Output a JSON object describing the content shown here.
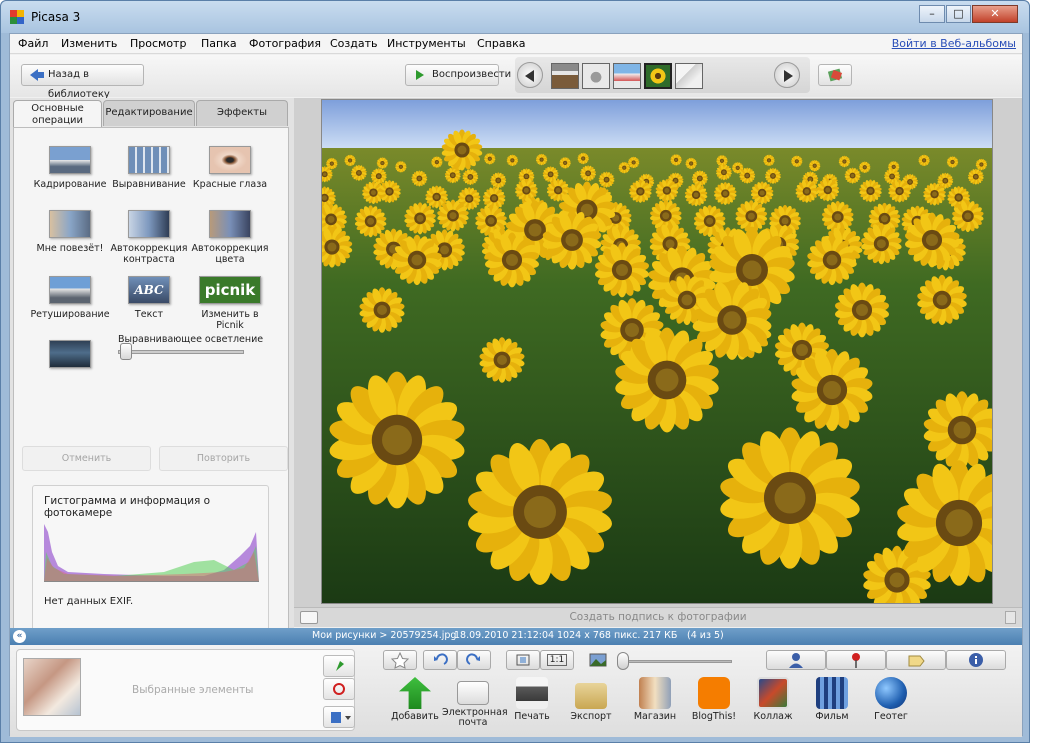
{
  "window": {
    "title": "Picasa 3",
    "controls": [
      "–",
      "□",
      "✕"
    ]
  },
  "menu": {
    "items": [
      "Файл",
      "Изменить",
      "Просмотр",
      "Папка",
      "Фотография",
      "Создать",
      "Инструменты",
      "Справка"
    ],
    "web_albums_link": "Войти в Веб-альбомы"
  },
  "toolbar": {
    "back_label": "Назад в библиотеку",
    "play_label": "Воспроизвести"
  },
  "tabs": [
    {
      "label": "Основные\nоперации",
      "active": true
    },
    {
      "label": "Редактирование",
      "active": false
    },
    {
      "label": "Эффекты",
      "active": false
    }
  ],
  "tools": [
    {
      "label": "Кадрирование",
      "icon": "crop-icon"
    },
    {
      "label": "Выравнивание",
      "icon": "straighten-icon"
    },
    {
      "label": "Красные глаза",
      "icon": "red-eye-icon"
    },
    {
      "label": "Мне повезёт!",
      "icon": "lucky-icon"
    },
    {
      "label": "Автокоррекция\nконтраста",
      "icon": "auto-contrast-icon"
    },
    {
      "label": "Автокоррекция\nцвета",
      "icon": "auto-color-icon"
    },
    {
      "label": "Ретуширование",
      "icon": "retouch-icon"
    },
    {
      "label": "Текст",
      "icon": "text-icon"
    },
    {
      "label": "Изменить в Picnik",
      "icon": "picnik-icon"
    }
  ],
  "picnik_logo": "picnik",
  "text_tool_glyph": "ABC",
  "fill_light": {
    "label": "Выравнивающее осветление",
    "value": 0
  },
  "undo_label": "Отменить",
  "redo_label": "Повторить",
  "histogram": {
    "title": "Гистограмма и информация о фотокамере",
    "exif": "Нет данных EXIF."
  },
  "caption": {
    "placeholder": "Создать подпись к фотографии"
  },
  "status": {
    "path": "Мои рисунки > 20579254.jpg",
    "date": "18.09.2010 21:12:04",
    "dimensions": "1024 x 768 пикс.",
    "size": "217 КБ",
    "position": "(4 из 5)"
  },
  "tray": {
    "label": "Выбранные элементы"
  },
  "actions": [
    {
      "label": "Добавить",
      "icon": "upload-icon"
    },
    {
      "label": "Электронная\nпочта",
      "icon": "email-icon"
    },
    {
      "label": "Печать",
      "icon": "print-icon"
    },
    {
      "label": "Экспорт",
      "icon": "export-folder-icon"
    },
    {
      "label": "Магазин",
      "icon": "shop-icon"
    },
    {
      "label": "BlogThis!",
      "icon": "blogger-icon"
    },
    {
      "label": "Коллаж",
      "icon": "collage-icon"
    },
    {
      "label": "Фильм",
      "icon": "movie-icon"
    },
    {
      "label": "Геотег",
      "icon": "geotag-icon"
    }
  ],
  "zoom_button_label": "1:1",
  "colors": {
    "accent": "#4b7fb1",
    "statusbar": "#5a8cbd",
    "sunflower": "#f2c616",
    "leaf": "#2f6b2a"
  }
}
